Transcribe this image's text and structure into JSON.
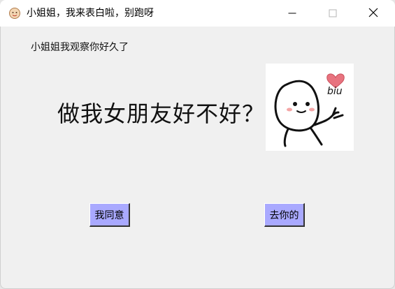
{
  "window": {
    "title": "小姐姐，我来表白啦，别跑呀",
    "icon": "face-app-icon",
    "controls": {
      "minimize": "minimize-icon",
      "maximize": "maximize-icon",
      "close": "close-icon"
    }
  },
  "content": {
    "subtitle": "小姐姐我观察你好久了",
    "question": "做我女朋友好不好？",
    "sticker": {
      "text": "biu",
      "icon": "heart-icon"
    }
  },
  "buttons": {
    "agree_label": "我同意",
    "refuse_label": "去你的"
  },
  "colors": {
    "button_bg": "#a9a9ff",
    "window_bg": "#f0f0f0",
    "heart": "#e8737f"
  }
}
